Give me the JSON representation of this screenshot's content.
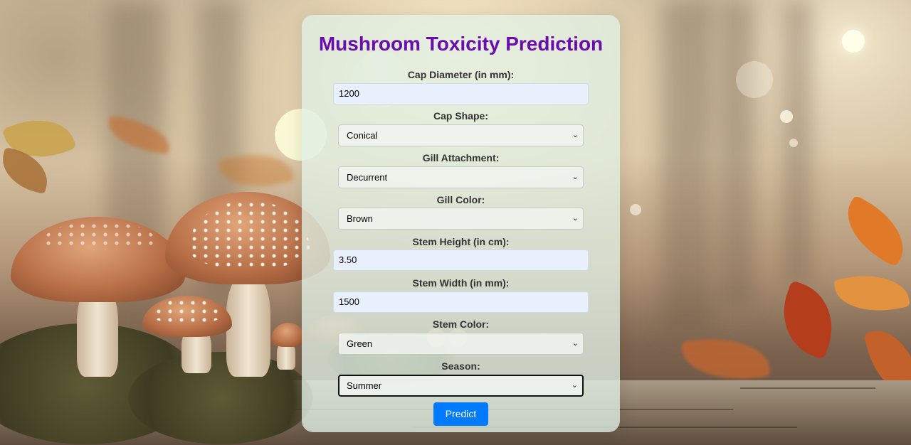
{
  "form": {
    "title": "Mushroom Toxicity Prediction",
    "fields": [
      {
        "label": "Cap Diameter (in mm):",
        "type": "input",
        "value": "1200"
      },
      {
        "label": "Cap Shape:",
        "type": "select",
        "value": "Conical"
      },
      {
        "label": "Gill Attachment:",
        "type": "select",
        "value": "Decurrent"
      },
      {
        "label": "Gill Color:",
        "type": "select",
        "value": "Brown"
      },
      {
        "label": "Stem Height (in cm):",
        "type": "input",
        "value": "3.50"
      },
      {
        "label": "Stem Width (in mm):",
        "type": "input",
        "value": "1500"
      },
      {
        "label": "Stem Color:",
        "type": "select",
        "value": "Green"
      },
      {
        "label": "Season:",
        "type": "select",
        "value": "Summer"
      }
    ],
    "submit_label": "Predict"
  },
  "icons": {
    "select_chevron": "chevron-down-icon"
  },
  "colors": {
    "title": "#6a0dad",
    "button": "#007bff",
    "input_fill": "#e8f0fe",
    "card": "#e0f0e4"
  }
}
